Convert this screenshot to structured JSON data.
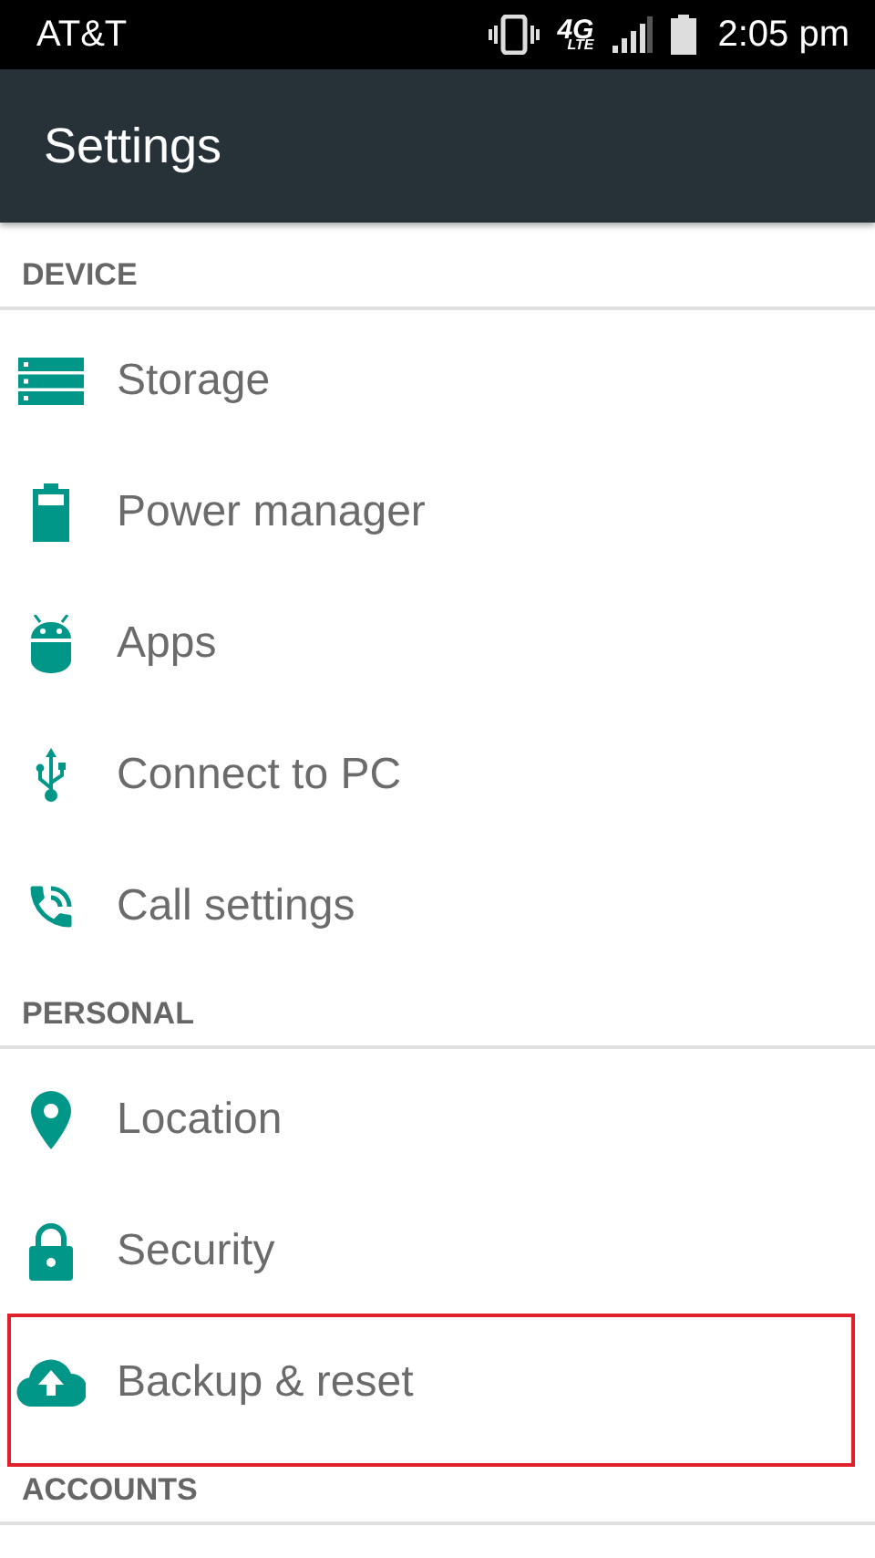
{
  "status_bar": {
    "carrier": "AT&T",
    "network": "4G",
    "network_sub": "LTE",
    "time": "2:05 pm"
  },
  "app_bar": {
    "title": "Settings"
  },
  "sections": [
    {
      "header": "DEVICE",
      "items": [
        {
          "label": "Storage",
          "highlighted": false
        },
        {
          "label": "Power manager",
          "highlighted": false
        },
        {
          "label": "Apps",
          "highlighted": false
        },
        {
          "label": "Connect to PC",
          "highlighted": false
        },
        {
          "label": "Call settings",
          "highlighted": false
        }
      ]
    },
    {
      "header": "PERSONAL",
      "items": [
        {
          "label": "Location",
          "highlighted": false
        },
        {
          "label": "Security",
          "highlighted": false
        },
        {
          "label": "Backup & reset",
          "highlighted": true
        }
      ]
    },
    {
      "header": "ACCOUNTS"
    }
  ]
}
